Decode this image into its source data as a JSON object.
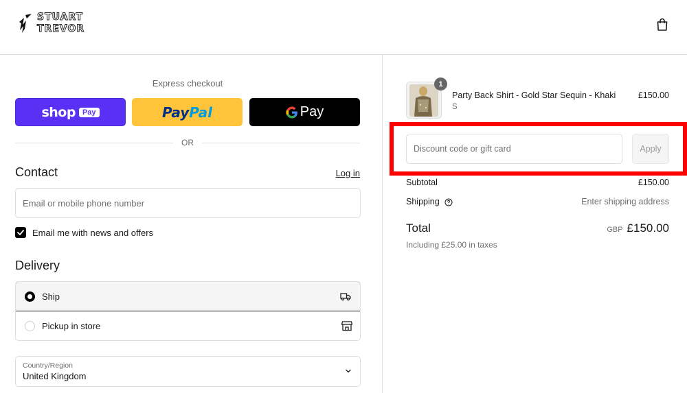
{
  "brand": {
    "line1": "STUART",
    "line2": "TREVOR"
  },
  "express": {
    "label": "Express checkout",
    "shop_word": "shop",
    "shop_badge": "Pay",
    "paypal_part1": "Pay",
    "paypal_part2": "Pal",
    "gpay_word": "Pay",
    "or_text": "OR"
  },
  "contact": {
    "title": "Contact",
    "login_label": "Log in",
    "email_placeholder": "Email or mobile phone number",
    "newsletter_label": "Email me with news and offers",
    "newsletter_checked": true
  },
  "delivery": {
    "title": "Delivery",
    "options": [
      {
        "label": "Ship",
        "selected": true,
        "icon": "truck-icon"
      },
      {
        "label": "Pickup in store",
        "selected": false,
        "icon": "store-icon"
      }
    ],
    "country_caption": "Country/Region",
    "country_value": "United Kingdom"
  },
  "order": {
    "item": {
      "name": "Party Back Shirt - Gold Star Sequin - Khaki",
      "variant": "S",
      "price": "£150.00",
      "quantity": "1"
    },
    "discount_placeholder": "Discount code or gift card",
    "apply_label": "Apply",
    "subtotal_label": "Subtotal",
    "subtotal_value": "£150.00",
    "shipping_label": "Shipping",
    "shipping_value": "Enter shipping address",
    "total_label": "Total",
    "total_currency": "GBP",
    "total_value": "£150.00",
    "tax_note": "Including £25.00 in taxes"
  },
  "colors": {
    "shop_purple": "#5a31f4",
    "paypal_yellow": "#ffc439",
    "gpay_black": "#000000",
    "highlight_red": "#ff0000"
  }
}
